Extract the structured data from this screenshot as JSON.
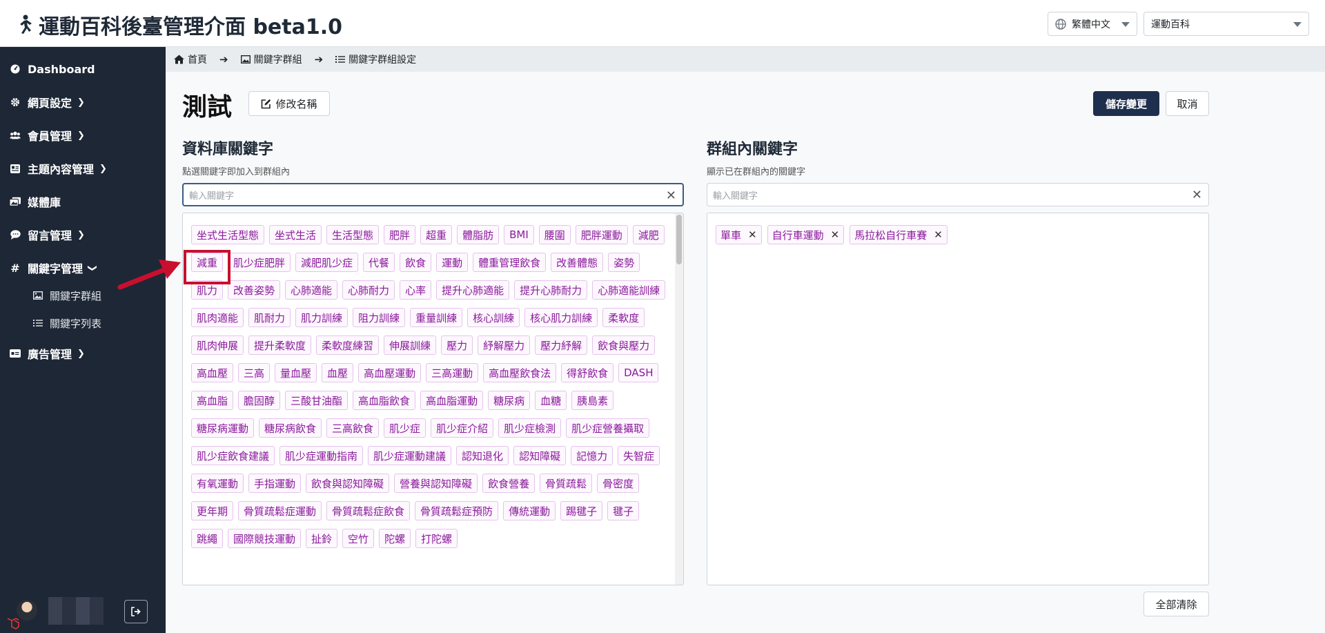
{
  "header": {
    "title": "運動百科後臺管理介面 beta1.0",
    "language": "繁體中文",
    "site": "運動百科"
  },
  "sidebar": {
    "items": [
      {
        "label": "Dashboard",
        "icon": "dashboard-icon"
      },
      {
        "label": "網頁設定",
        "icon": "gear-icon"
      },
      {
        "label": "會員管理",
        "icon": "users-icon"
      },
      {
        "label": "主題內容管理",
        "icon": "content-icon"
      },
      {
        "label": "媒體庫",
        "icon": "images-icon"
      },
      {
        "label": "留言管理",
        "icon": "comment-icon"
      },
      {
        "label": "關鍵字管理",
        "icon": "hash-icon"
      },
      {
        "label": "廣告管理",
        "icon": "ad-icon"
      }
    ],
    "sub_items": [
      {
        "label": "關鍵字群組",
        "icon": "image-icon"
      },
      {
        "label": "關鍵字列表",
        "icon": "list-icon"
      }
    ]
  },
  "breadcrumb": [
    "首頁",
    "關鍵字群組",
    "關鍵字群組設定"
  ],
  "page": {
    "title": "測試",
    "rename_label": "修改名稱",
    "save_label": "儲存變更",
    "cancel_label": "取消",
    "clear_all_label": "全部清除"
  },
  "db_section": {
    "title": "資料庫關鍵字",
    "subtitle": "點選關鍵字即加入到群組內",
    "search_placeholder": "輸入關鍵字",
    "tags": [
      "坐式生活型態",
      "坐式生活",
      "生活型態",
      "肥胖",
      "超重",
      "體脂肪",
      "BMI",
      "腰圍",
      "肥胖運動",
      "減肥",
      "減重",
      "肌少症肥胖",
      "減肥肌少症",
      "代餐",
      "飲食",
      "運動",
      "體重管理飲食",
      "改善體態",
      "姿勢",
      "肌力",
      "改善姿勢",
      "心肺適能",
      "心肺耐力",
      "心率",
      "提升心肺適能",
      "提升心肺耐力",
      "心肺適能訓練",
      "肌肉適能",
      "肌耐力",
      "肌力訓練",
      "阻力訓練",
      "重量訓練",
      "核心訓練",
      "核心肌力訓練",
      "柔軟度",
      "肌肉伸展",
      "提升柔軟度",
      "柔軟度練習",
      "伸展訓練",
      "壓力",
      "紓解壓力",
      "壓力紓解",
      "飲食與壓力",
      "高血壓",
      "三高",
      "量血壓",
      "血壓",
      "高血壓運動",
      "三高運動",
      "高血壓飲食法",
      "得舒飲食",
      "DASH",
      "高血脂",
      "膽固醇",
      "三酸甘油酯",
      "高血脂飲食",
      "高血脂運動",
      "糖尿病",
      "血糖",
      "胰島素",
      "糖尿病運動",
      "糖尿病飲食",
      "三高飲食",
      "肌少症",
      "肌少症介紹",
      "肌少症檢測",
      "肌少症營養攝取",
      "肌少症飲食建議",
      "肌少症運動指南",
      "肌少症運動建議",
      "認知退化",
      "認知障礙",
      "記憶力",
      "失智症",
      "有氧運動",
      "手指運動",
      "飲食與認知障礙",
      "營養與認知障礙",
      "飲食營養",
      "骨質疏鬆",
      "骨密度",
      "更年期",
      "骨質疏鬆症運動",
      "骨質疏鬆症飲食",
      "骨質疏鬆症預防",
      "傳統運動",
      "踢毽子",
      "毽子",
      "跳繩",
      "國際競技運動",
      "扯鈴",
      "空竹",
      "陀螺",
      "打陀螺"
    ]
  },
  "group_section": {
    "title": "群組內關鍵字",
    "subtitle": "顯示已在群組內的關鍵字",
    "search_placeholder": "輸入關鍵字",
    "tags": [
      "單車",
      "自行車運動",
      "馬拉松自行車賽"
    ]
  },
  "annotation": {
    "highlighted_tag": "減肥",
    "color": "#c8102e"
  }
}
